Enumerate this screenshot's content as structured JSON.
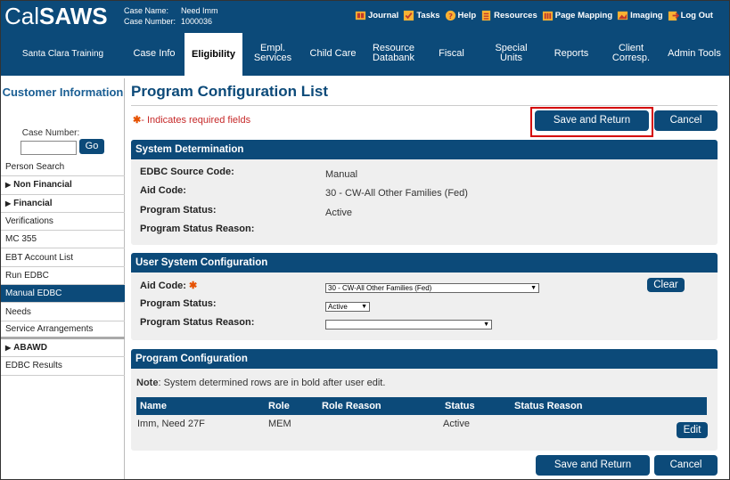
{
  "header": {
    "logo_left": "Cal",
    "logo_right": "SAWS",
    "case_name_label": "Case Name:",
    "case_name": "Need Imm",
    "case_number_label": "Case Number:",
    "case_number": "1000036",
    "links": [
      {
        "label": "Journal",
        "icon": "journal-icon",
        "color": "#f9b233"
      },
      {
        "label": "Tasks",
        "icon": "tasks-icon",
        "color": "#f9b233"
      },
      {
        "label": "Help",
        "icon": "help-icon",
        "color": "#f9b233"
      },
      {
        "label": "Resources",
        "icon": "resources-icon",
        "color": "#f9b233"
      },
      {
        "label": "Page Mapping",
        "icon": "page-mapping-icon",
        "color": "#f9b233"
      },
      {
        "label": "Imaging",
        "icon": "imaging-icon",
        "color": "#f9b233"
      },
      {
        "label": "Log Out",
        "icon": "logout-icon",
        "color": "#f9b233"
      }
    ]
  },
  "nav": {
    "org": "Santa Clara Training",
    "items": [
      "Case Info",
      "Eligibility",
      "Empl. Services",
      "Child Care",
      "Resource Databank",
      "Fiscal",
      "Special Units",
      "Reports",
      "Client Corresp.",
      "Admin Tools"
    ],
    "active": "Eligibility"
  },
  "sidebar": {
    "title": "Customer Information",
    "case_number_label": "Case Number:",
    "go_label": "Go",
    "items": [
      {
        "label": "Person Search"
      },
      {
        "label": "Non Financial",
        "expandable": true
      },
      {
        "label": "Financial",
        "expandable": true
      },
      {
        "label": "Verifications"
      },
      {
        "label": "MC 355"
      },
      {
        "label": "EBT Account List"
      },
      {
        "label": "Run EDBC"
      },
      {
        "label": "Manual EDBC",
        "selected": true
      },
      {
        "label": "Needs"
      },
      {
        "label": "Service Arrangements"
      },
      {
        "label": "ABAWD",
        "expandable": true
      },
      {
        "label": "EDBC Results"
      }
    ]
  },
  "main": {
    "title": "Program Configuration List",
    "required_note": "- Indicates required fields",
    "required_star": "✱",
    "save_return_label": "Save and Return",
    "cancel_label": "Cancel",
    "system_determination": {
      "header": "System Determination",
      "rows": [
        {
          "label": "EDBC Source Code:",
          "value": "Manual"
        },
        {
          "label": "Aid Code:",
          "value": "30 - CW-All Other Families (Fed)"
        },
        {
          "label": "Program Status:",
          "value": "Active"
        },
        {
          "label": "Program Status Reason:",
          "value": ""
        }
      ]
    },
    "user_config": {
      "header": "User System Configuration",
      "aid_code_label": "Aid Code:",
      "aid_code_value": "30 - CW-All Other Families (Fed)",
      "program_status_label": "Program Status:",
      "program_status_value": "Active",
      "program_status_reason_label": "Program Status Reason:",
      "program_status_reason_value": "",
      "clear_label": "Clear"
    },
    "program_config": {
      "header": "Program Configuration",
      "note_bold": "Note",
      "note_text": ": System determined rows are in bold after user edit.",
      "columns": [
        "Name",
        "Role",
        "Role Reason",
        "Status",
        "Status Reason"
      ],
      "rows": [
        {
          "name": "Imm, Need 27F",
          "role": "MEM",
          "role_reason": "",
          "status": "Active",
          "status_reason": ""
        }
      ],
      "edit_label": "Edit"
    }
  },
  "colors": {
    "brand": "#0c4a79",
    "highlight": "#d40000",
    "required": "#c62828"
  }
}
